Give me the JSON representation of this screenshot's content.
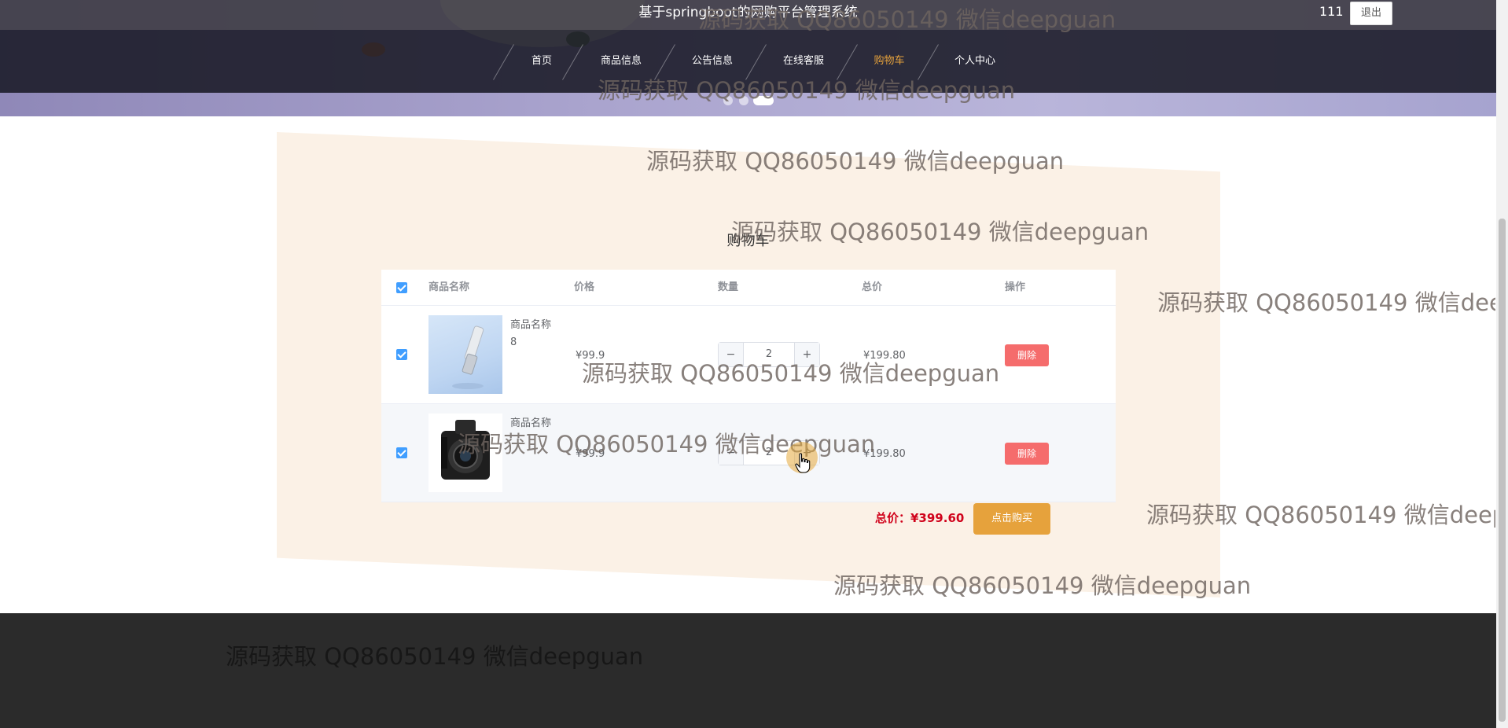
{
  "header": {
    "site_title": "基于springboot的网购平台管理系统",
    "user_name": "111",
    "logout_label": "退出",
    "nav": [
      {
        "label": "首页",
        "active": false
      },
      {
        "label": "商品信息",
        "active": false
      },
      {
        "label": "公告信息",
        "active": false
      },
      {
        "label": "在线客服",
        "active": false
      },
      {
        "label": "购物车",
        "active": true
      },
      {
        "label": "个人中心",
        "active": false
      }
    ],
    "carousel_active_index": 2
  },
  "cart": {
    "title": "购物车",
    "columns": {
      "name": "商品名称",
      "price": "价格",
      "quantity": "数量",
      "subtotal": "总价",
      "action": "操作"
    },
    "items": [
      {
        "name": "商品名称8",
        "price": "¥99.9",
        "quantity": "2",
        "subtotal": "¥199.80",
        "delete_label": "删除",
        "checked": true,
        "image": "bottle-image"
      },
      {
        "name": "商品名称",
        "price": "¥99.9",
        "quantity": "2",
        "subtotal": "¥199.80",
        "delete_label": "删除",
        "checked": true,
        "image": "camera-image"
      }
    ],
    "total_label": "总价：¥399.60",
    "buy_label": "点击购买"
  },
  "watermark_text": "源码获取 QQ86050149 微信deepguan",
  "colors": {
    "accent": "#e6a23c",
    "danger": "#f56c6c",
    "checkbox": "#409eff",
    "total": "#d0021b"
  }
}
